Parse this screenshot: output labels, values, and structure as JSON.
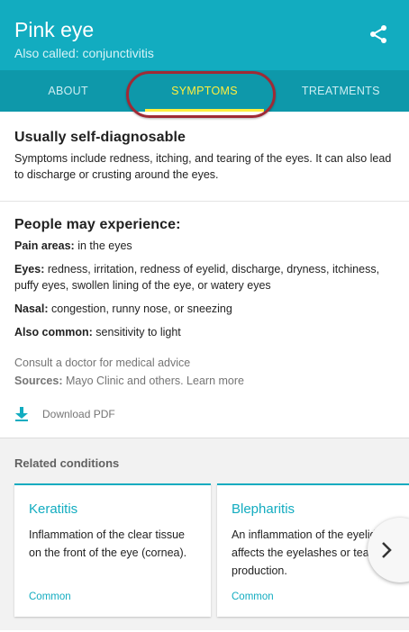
{
  "header": {
    "title": "Pink eye",
    "subtitle": "Also called: conjunctivitis",
    "share_icon": "share-icon"
  },
  "tabs": [
    {
      "label": "ABOUT",
      "active": false
    },
    {
      "label": "SYMPTOMS",
      "active": true
    },
    {
      "label": "TREATMENTS",
      "active": false
    }
  ],
  "summary": {
    "heading": "Usually self-diagnosable",
    "text": "Symptoms include redness, itching, and tearing of the eyes. It can also lead to discharge or crusting around the eyes."
  },
  "experience": {
    "heading": "People may experience:",
    "items": [
      {
        "label": "Pain areas:",
        "value": " in the eyes"
      },
      {
        "label": "Eyes:",
        "value": " redness, irritation, redness of eyelid, discharge, dryness, itchiness, puffy eyes, swollen lining of the eye, or watery eyes"
      },
      {
        "label": "Nasal:",
        "value": " congestion, runny nose, or sneezing"
      },
      {
        "label": "Also common:",
        "value": " sensitivity to light"
      }
    ],
    "consult": "Consult a doctor for medical advice",
    "sources_label": "Sources:",
    "sources_value": " Mayo Clinic and others. Learn more",
    "download_label": "Download PDF"
  },
  "related": {
    "title": "Related conditions",
    "cards": [
      {
        "name": "Keratitis",
        "text": "Inflammation of the clear tissue on the front of the eye (cornea).",
        "tag": "Common"
      },
      {
        "name": "Blepharitis",
        "text": "An inflammation of the eyelid that affects the eyelashes or tear production.",
        "tag": "Common"
      }
    ]
  },
  "colors": {
    "header": "#12acc0",
    "tabs": "#0e98aa",
    "active_tab": "#ffee3e",
    "annotation": "#a02a35"
  }
}
